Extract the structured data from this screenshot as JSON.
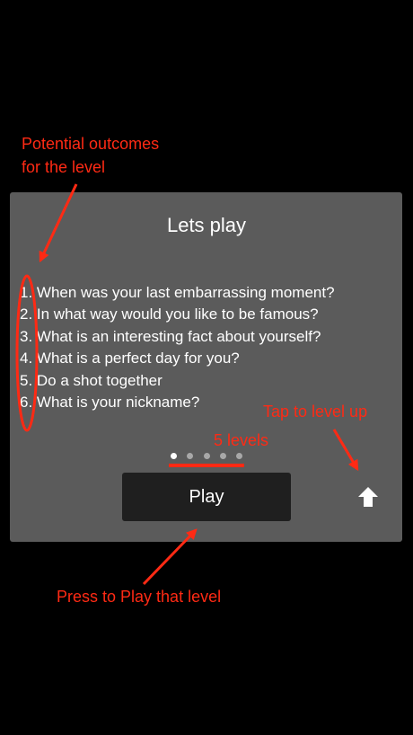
{
  "panel": {
    "title": "Lets play",
    "questions": [
      "1. When was your last embarrassing moment?",
      "2. In what way would you like to be famous?",
      "3. What is an interesting fact about yourself?",
      "4. What is a perfect day for you?",
      "5. Do a shot together",
      "6. What is your nickname?"
    ],
    "page_indicator": {
      "total": 5,
      "current": 1
    },
    "play_label": "Play",
    "level_up_icon": "up-arrow-icon"
  },
  "annotations": {
    "outcomes_line1": "Potential outcomes",
    "outcomes_line2": "for the level",
    "levels": "5 levels",
    "tap_level_up": "Tap to level up",
    "press_play": "Press to Play that level",
    "color": "#ff2a14"
  },
  "colors": {
    "background": "#000000",
    "panel": "#5b5b5b",
    "button": "#1f1f1f",
    "text": "#ffffff"
  }
}
